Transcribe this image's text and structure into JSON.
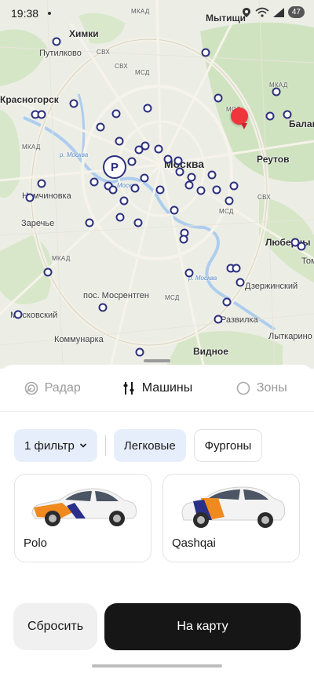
{
  "status_bar": {
    "time": "19:38",
    "battery": "47"
  },
  "map": {
    "labels": {
      "khimki": "Химки",
      "mytishchi": "Мытищи",
      "putilkovo": "Путилково",
      "krasnogorsk": "Красногорск",
      "moskva": "Москва",
      "reutov": "Реутов",
      "balashikha": "Балаш",
      "nemchinovka": "Немчиновка",
      "zarechye": "Заречье",
      "lyubertsy": "Люберцы",
      "tom": "Том",
      "dzerzhinsky": "Дзержинский",
      "mosrentgen": "пос. Мосрентген",
      "moskovsky": "Московский",
      "kommunarka": "Коммунарка",
      "razvilka": "Развилка",
      "vidnoe": "Видное",
      "lytkarino": "Лыткарино",
      "road_mkad": "МКАД",
      "road_svh": "СВХ",
      "road_mcd": "МСД",
      "river_moskva": "р. Москва"
    },
    "parking_letter": "P"
  },
  "sheet": {
    "tabs": [
      {
        "label": "Радар",
        "icon": "radar-icon"
      },
      {
        "label": "Машины",
        "icon": "sliders-icon"
      },
      {
        "label": "Зоны",
        "icon": "circle-icon"
      }
    ],
    "active_tab": "Машины",
    "filters": {
      "filter_count_label": "1 фильтр",
      "categories": [
        "Легковые",
        "Фургоны"
      ],
      "selected_category": "Легковые"
    },
    "cars": [
      {
        "name": "Polo"
      },
      {
        "name": "Qashqai"
      }
    ],
    "buttons": {
      "reset": "Сбросить",
      "to_map": "На карту"
    }
  },
  "colors": {
    "accent_blue_chip": "#e7eefb",
    "pin_red": "#f0353c",
    "marker_navy": "#2b2f7d",
    "primary_button": "#161616"
  }
}
